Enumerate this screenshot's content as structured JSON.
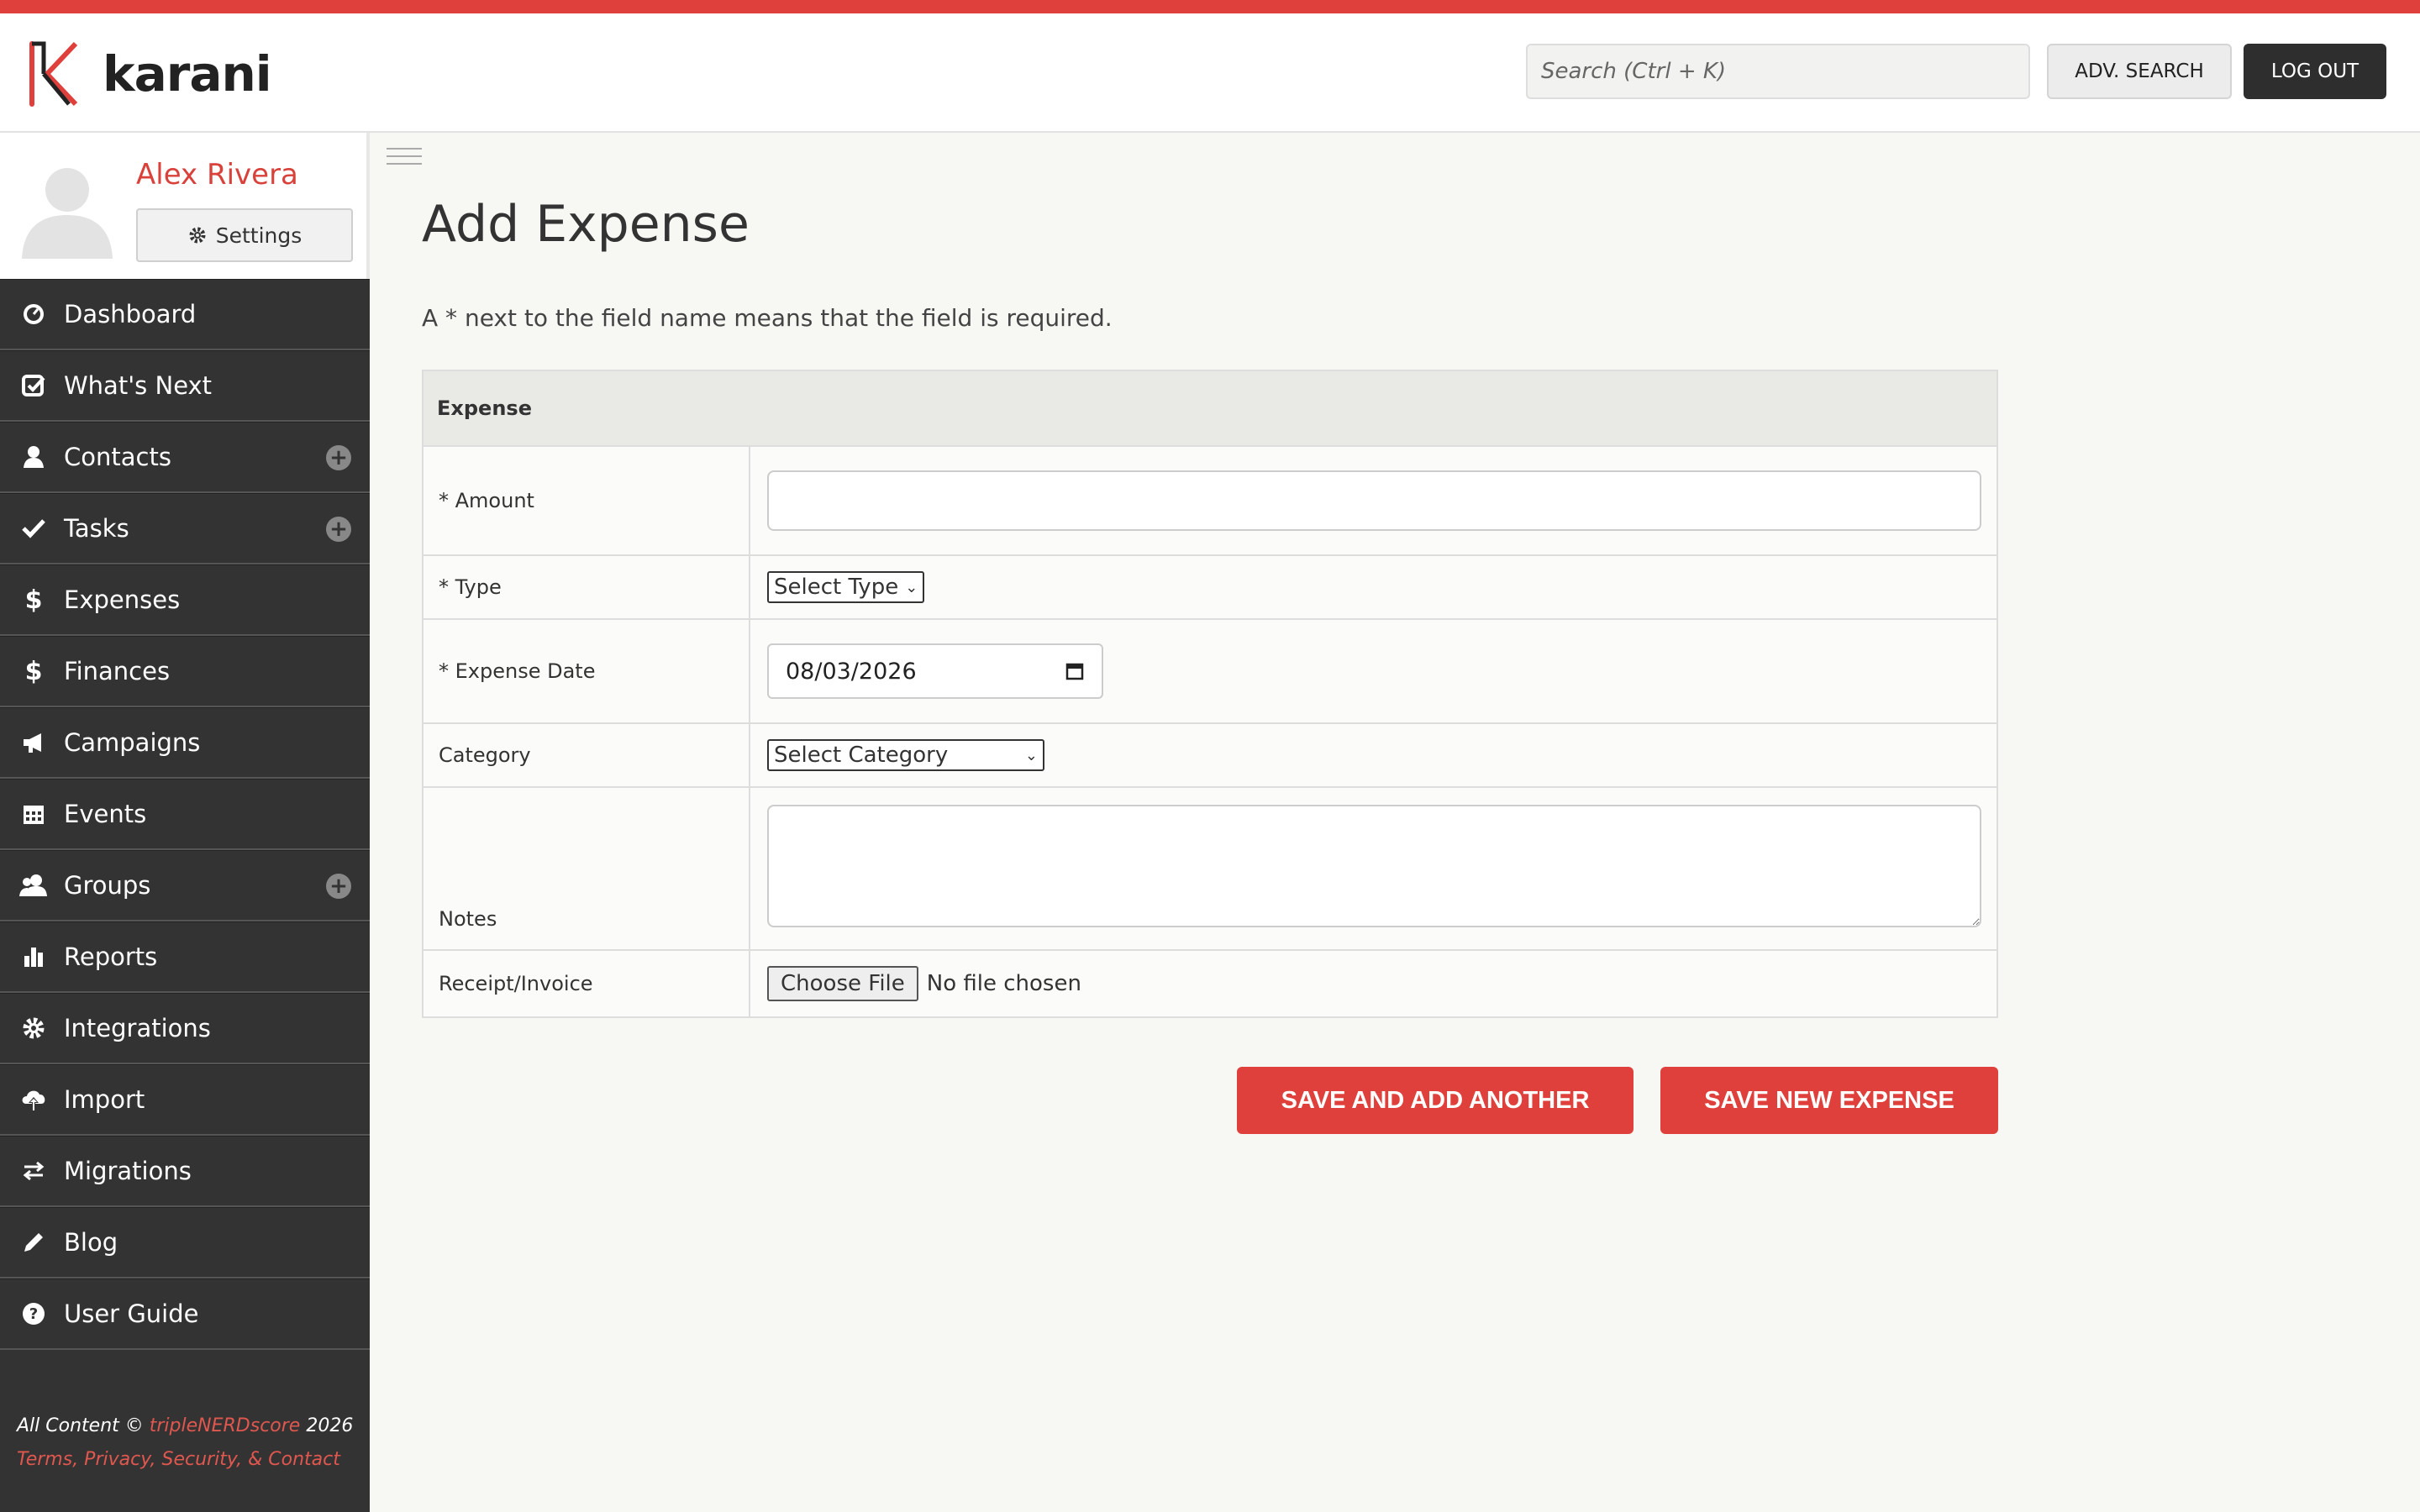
{
  "app": {
    "name": "karani"
  },
  "header": {
    "search_placeholder": "Search (Ctrl + K)",
    "adv_search_label": "ADV. SEARCH",
    "logout_label": "LOG OUT"
  },
  "profile": {
    "name": "Alex Rivera",
    "settings_label": "Settings"
  },
  "sidebar": {
    "items": [
      {
        "label": "Dashboard",
        "icon": "dashboard-icon"
      },
      {
        "label": "What's Next",
        "icon": "check-square-icon"
      },
      {
        "label": "Contacts",
        "icon": "user-icon",
        "add": true
      },
      {
        "label": "Tasks",
        "icon": "checkmark-icon",
        "add": true
      },
      {
        "label": "Expenses",
        "icon": "dollar-icon"
      },
      {
        "label": "Finances",
        "icon": "dollar-icon"
      },
      {
        "label": "Campaigns",
        "icon": "megaphone-icon"
      },
      {
        "label": "Events",
        "icon": "calendar-icon"
      },
      {
        "label": "Groups",
        "icon": "group-icon",
        "add": true
      },
      {
        "label": "Reports",
        "icon": "bar-chart-icon"
      },
      {
        "label": "Integrations",
        "icon": "gear-icon"
      },
      {
        "label": "Import",
        "icon": "cloud-upload-icon"
      },
      {
        "label": "Migrations",
        "icon": "swap-arrows-icon"
      },
      {
        "label": "Blog",
        "icon": "pencil-icon"
      },
      {
        "label": "User Guide",
        "icon": "question-icon"
      }
    ]
  },
  "footer": {
    "prefix": "All Content © ",
    "company": "tripleNERDscore",
    "year": " 2026",
    "links": "Terms, Privacy, Security, & Contact"
  },
  "main": {
    "title": "Add Expense",
    "required_note": "A * next to the field name means that the field is required.",
    "section_header": "Expense",
    "fields": {
      "amount_label": "* Amount",
      "type_label": "* Type",
      "type_value": "Select Type",
      "date_label": "* Expense Date",
      "date_value": "08/03/2026",
      "category_label": "Category",
      "category_value": "Select Category",
      "notes_label": "Notes",
      "receipt_label": "Receipt/Invoice",
      "file_button": "Choose File",
      "file_status": "No file chosen"
    },
    "buttons": {
      "save_add_another": "SAVE AND ADD ANOTHER",
      "save_new": "SAVE NEW EXPENSE"
    }
  },
  "colors": {
    "accent": "#e0403b",
    "sidebar": "#333333",
    "background": "#f7f7f4"
  }
}
